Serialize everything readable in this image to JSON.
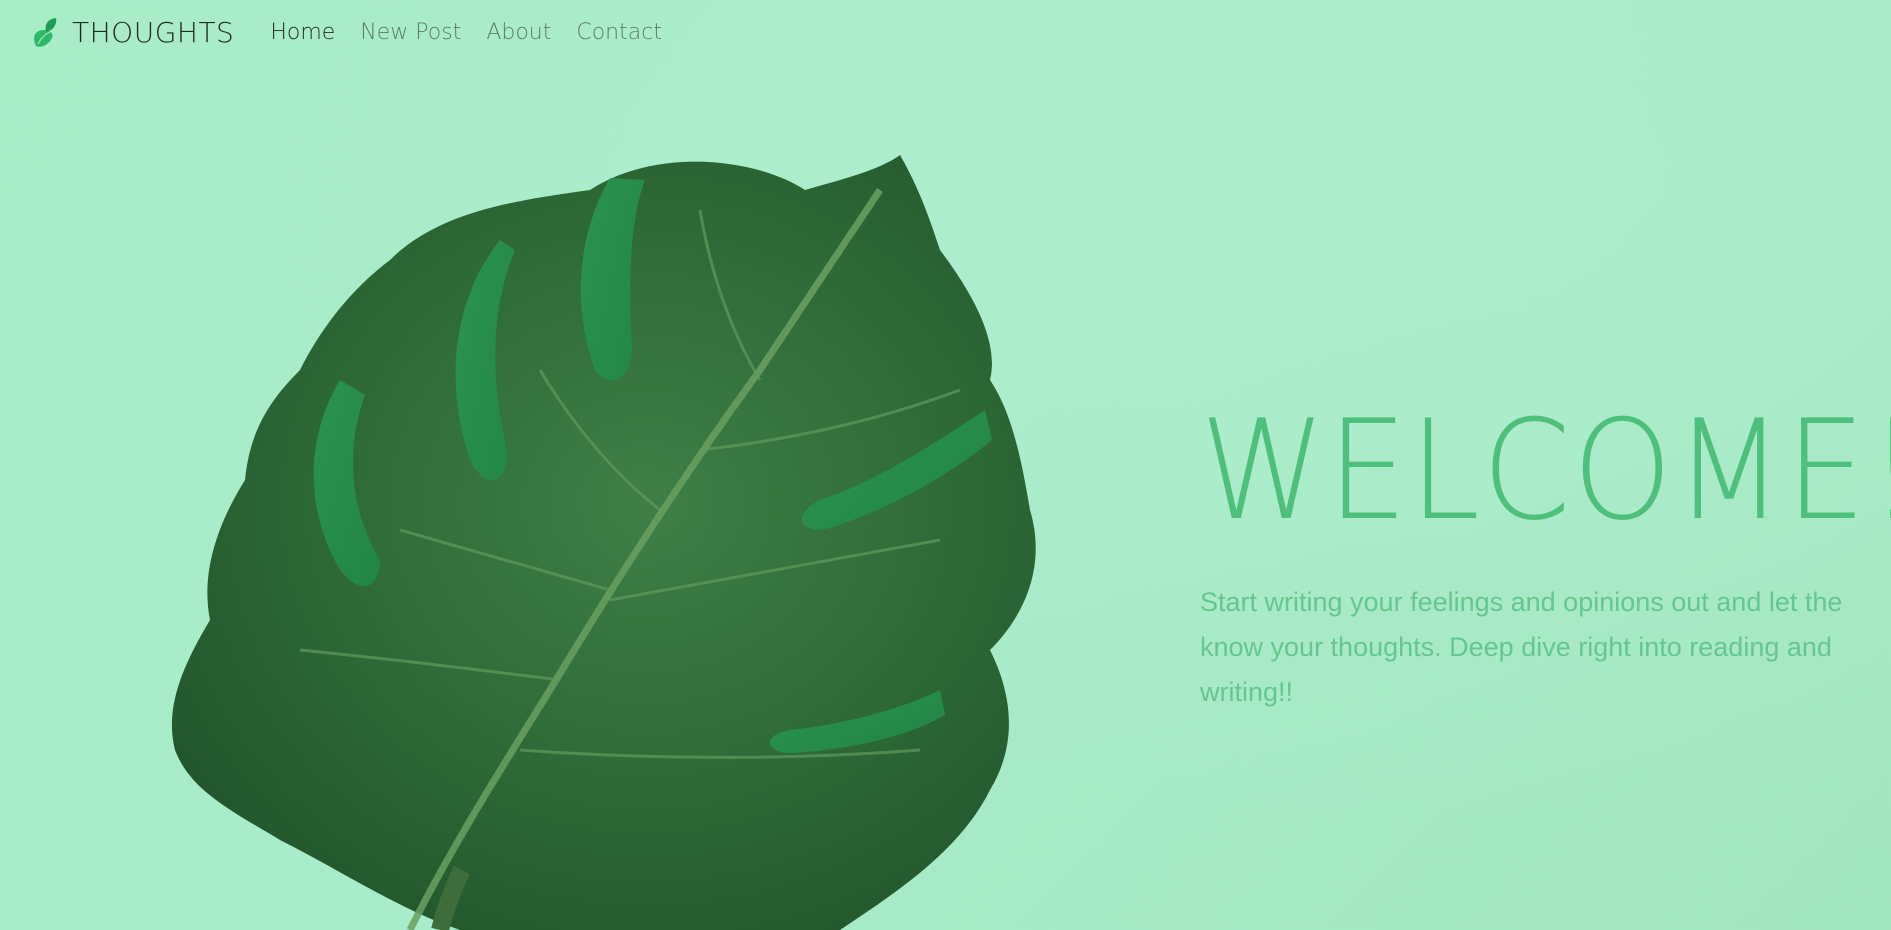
{
  "brand": {
    "name": "THOUGHTS",
    "icon": "leaf-icon"
  },
  "nav": {
    "items": [
      {
        "label": "Home",
        "active": true
      },
      {
        "label": "New Post",
        "active": false
      },
      {
        "label": "About",
        "active": false
      },
      {
        "label": "Contact",
        "active": false
      }
    ]
  },
  "hero": {
    "title": "WELCOME!",
    "lines": [
      "Start writing your feelings and opinions out and let the",
      "know your thoughts. Deep dive right into reading and",
      "writing!!"
    ],
    "image": "monstera-leaf"
  },
  "colors": {
    "background": "#a8ecc8",
    "accent": "#4fbf7d",
    "brand_text": "#1d2a22",
    "nav_muted": "#5b7b69",
    "leaf_dark": "#2f6b3a"
  }
}
